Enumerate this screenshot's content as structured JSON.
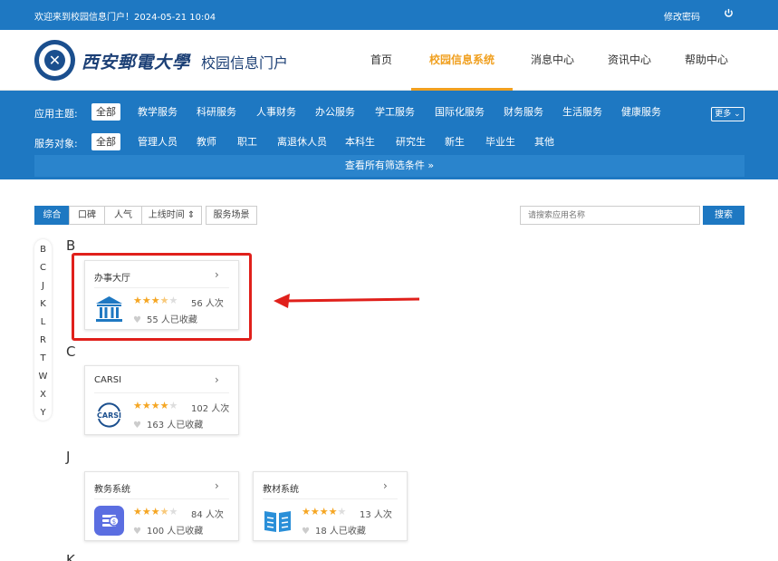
{
  "topbar": {
    "welcome": "欢迎来到校园信息门户！2024-05-21 10:04",
    "change_password": "修改密码",
    "power_icon": "power-icon"
  },
  "header": {
    "university": "西安郵電大學",
    "portal": "校园信息门户",
    "nav": [
      "首页",
      "校园信息系统",
      "消息中心",
      "资讯中心",
      "帮助中心"
    ],
    "active_nav": "校园信息系统"
  },
  "filter": {
    "theme_label": "应用主题:",
    "themes": [
      "全部",
      "教学服务",
      "科研服务",
      "人事财务",
      "办公服务",
      "学工服务",
      "国际化服务",
      "财务服务",
      "生活服务",
      "健康服务"
    ],
    "more": "更多",
    "audience_label": "服务对象:",
    "audiences": [
      "全部",
      "管理人员",
      "教师",
      "职工",
      "离退休人员",
      "本科生",
      "研究生",
      "新生",
      "毕业生",
      "其他"
    ],
    "view_all": "查看所有筛选条件"
  },
  "sort": {
    "tabs": [
      "综合",
      "口碑",
      "人气",
      "上线时间",
      "服务场景"
    ],
    "active": "综合"
  },
  "search": {
    "placeholder": "请搜索应用名称",
    "button": "搜索"
  },
  "letters": [
    "B",
    "C",
    "J",
    "K",
    "L",
    "R",
    "T",
    "W",
    "X",
    "Y"
  ],
  "sections": [
    {
      "letter": "B"
    },
    {
      "letter": "C"
    },
    {
      "letter": "J"
    },
    {
      "letter": "K"
    }
  ],
  "apps": [
    {
      "name": "办事大厅",
      "count": "56 人次",
      "fav": "55 人已收藏",
      "rating": 3.5,
      "icon": "bank-building-icon",
      "color": "#1e78c2"
    },
    {
      "name": "CARSI",
      "count": "102 人次",
      "fav": "163 人已收藏",
      "rating": 4,
      "icon": "carsi-logo-icon",
      "icon_text": "CARSI",
      "color": "#1b4f8e"
    },
    {
      "name": "教务系统",
      "count": "84 人次",
      "fav": "100 人已收藏",
      "rating": 3.5,
      "icon": "money-stack-icon",
      "color": "#5b6ee1"
    },
    {
      "name": "教材系统",
      "count": "13 人次",
      "fav": "18 人已收藏",
      "rating": 4,
      "icon": "open-book-icon",
      "color": "#2a8fd8"
    }
  ]
}
